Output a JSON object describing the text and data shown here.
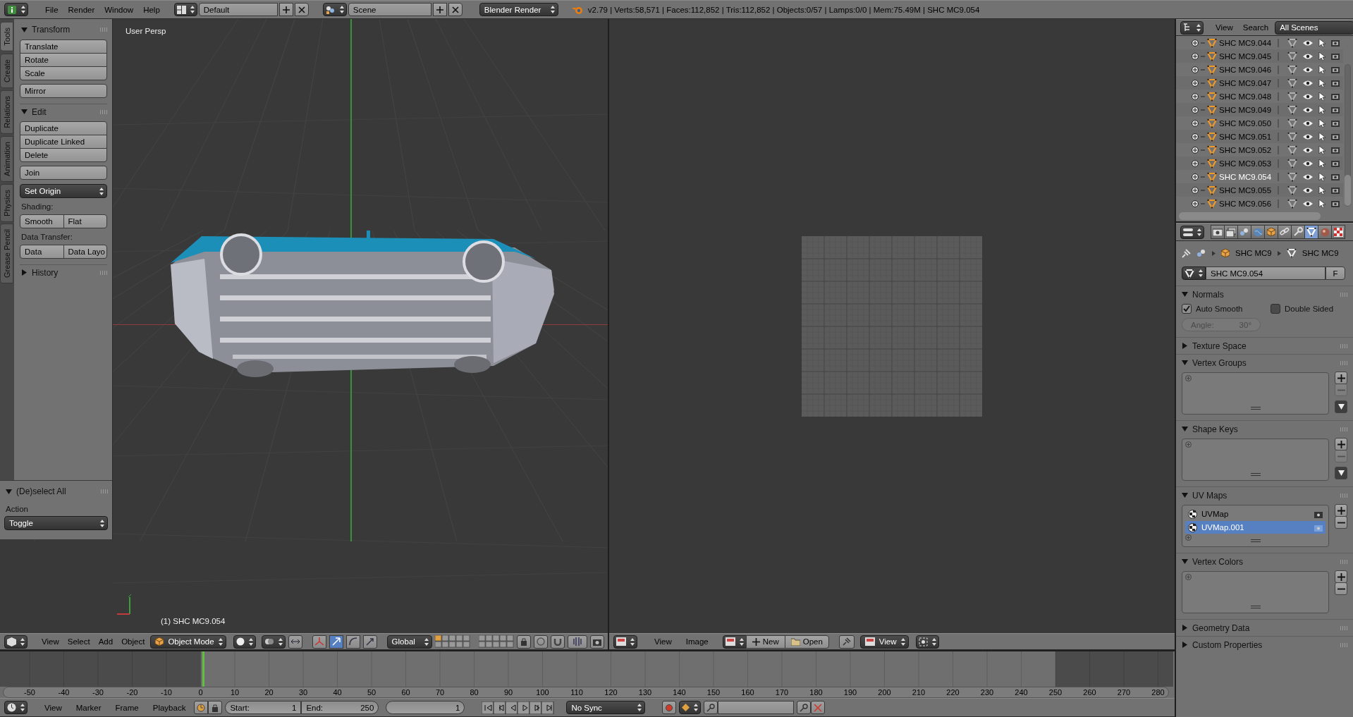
{
  "top_bar": {
    "menus": [
      "File",
      "Render",
      "Window",
      "Help"
    ],
    "screen_layout": "Default",
    "scene": "Scene",
    "render_engine": "Blender Render",
    "stats": "v2.79 | Verts:58,571 | Faces:112,852 | Tris:112,852 | Objects:0/57 | Lamps:0/0 | Mem:75.49M | SHC MC9.054"
  },
  "tool_shelf": {
    "tabs": [
      {
        "label": "Tools",
        "selected": true
      },
      {
        "label": "Create",
        "selected": false
      },
      {
        "label": "Relations",
        "selected": false
      },
      {
        "label": "Animation",
        "selected": false
      },
      {
        "label": "Physics",
        "selected": false
      },
      {
        "label": "Grease Pencil",
        "selected": false
      }
    ],
    "panels": [
      {
        "title": "Transform",
        "expanded": true,
        "items": [
          {
            "kind": "column",
            "buttons": [
              "Translate",
              "Rotate",
              "Scale"
            ]
          },
          {
            "kind": "column",
            "buttons": [
              "Mirror"
            ]
          }
        ]
      },
      {
        "title": "Edit",
        "expanded": true,
        "items": [
          {
            "kind": "column",
            "buttons": [
              "Duplicate",
              "Duplicate Linked",
              "Delete"
            ]
          },
          {
            "kind": "column",
            "buttons": [
              "Join"
            ]
          },
          {
            "kind": "dropdown",
            "value": "Set Origin"
          },
          {
            "kind": "label",
            "text": "Shading:"
          },
          {
            "kind": "row",
            "buttons": [
              "Smooth",
              "Flat"
            ]
          },
          {
            "kind": "label",
            "text": "Data Transfer:"
          },
          {
            "kind": "row",
            "buttons": [
              "Data",
              "Data Layo"
            ]
          }
        ]
      },
      {
        "title": "History",
        "expanded": false
      }
    ]
  },
  "operator_panel": {
    "title": "(De)select All",
    "expanded": true,
    "label": "Action",
    "value": "Toggle"
  },
  "viewport": {
    "view_name": "User Persp",
    "object_label": "(1) SHC MC9.054"
  },
  "view3d_header": {
    "menus": [
      "View",
      "Select",
      "Add",
      "Object"
    ],
    "mode": "Object Mode",
    "orientation": "Global"
  },
  "image_editor_header": {
    "menus": [
      "View",
      "Image"
    ],
    "buttons": [
      "New",
      "Open"
    ],
    "view": "View"
  },
  "timeline": {
    "ticks": [
      "-50",
      "-40",
      "-30",
      "-20",
      "-10",
      "0",
      "10",
      "20",
      "30",
      "40",
      "50",
      "60",
      "70",
      "80",
      "90",
      "100",
      "110",
      "120",
      "130",
      "140",
      "150",
      "160",
      "170",
      "180",
      "190",
      "200",
      "210",
      "220",
      "230",
      "240",
      "250",
      "260",
      "270",
      "280"
    ],
    "menus": [
      "View",
      "Marker",
      "Frame",
      "Playback"
    ],
    "start_label": "Start:",
    "start": "1",
    "end_label": "End:",
    "end": "250",
    "current_frame": "1",
    "sync": "No Sync"
  },
  "outliner": {
    "menus": [
      "View",
      "Search"
    ],
    "display": "All Scenes",
    "rows": [
      {
        "name": "SHC MC9.044",
        "selected": false
      },
      {
        "name": "SHC MC9.045",
        "selected": false
      },
      {
        "name": "SHC MC9.046",
        "selected": false
      },
      {
        "name": "SHC MC9.047",
        "selected": false
      },
      {
        "name": "SHC MC9.048",
        "selected": false
      },
      {
        "name": "SHC MC9.049",
        "selected": false
      },
      {
        "name": "SHC MC9.050",
        "selected": false
      },
      {
        "name": "SHC MC9.051",
        "selected": false
      },
      {
        "name": "SHC MC9.052",
        "selected": false
      },
      {
        "name": "SHC MC9.053",
        "selected": false
      },
      {
        "name": "SHC MC9.054",
        "selected": true
      },
      {
        "name": "SHC MC9.055",
        "selected": false
      },
      {
        "name": "SHC MC9.056",
        "selected": false
      }
    ]
  },
  "properties": {
    "tabs": [
      {
        "kind": "render",
        "selected": false
      },
      {
        "kind": "layers",
        "selected": false
      },
      {
        "kind": "scene",
        "selected": false
      },
      {
        "kind": "world",
        "selected": false
      },
      {
        "kind": "object",
        "selected": false
      },
      {
        "kind": "constraints",
        "selected": false
      },
      {
        "kind": "modifiers",
        "selected": false
      },
      {
        "kind": "data",
        "selected": true
      },
      {
        "kind": "material",
        "selected": false
      },
      {
        "kind": "texture",
        "selected": false
      }
    ],
    "breadcrumb": [
      "SHC MC9",
      "SHC MC9"
    ],
    "datablock": "SHC MC9.054",
    "fake_user": "F",
    "panels": [
      {
        "title": "Normals",
        "expanded": true,
        "kind": "normals",
        "checkboxes": [
          {
            "label": "Auto Smooth",
            "checked": true
          },
          {
            "label": "Double Sided",
            "checked": false
          }
        ],
        "field": {
          "label": "Angle:",
          "value": "30°",
          "disabled": true
        }
      },
      {
        "title": "Texture Space",
        "expanded": false
      },
      {
        "title": "Vertex Groups",
        "expanded": true,
        "kind": "list",
        "side_buttons": [
          {
            "kind": "add",
            "disabled": false
          },
          {
            "kind": "remove",
            "disabled": true
          },
          {
            "kind": "menu",
            "disabled": false
          }
        ]
      },
      {
        "title": "Shape Keys",
        "expanded": true,
        "kind": "list",
        "side_buttons": [
          {
            "kind": "add",
            "disabled": false
          },
          {
            "kind": "remove",
            "disabled": true
          },
          {
            "kind": "menu",
            "disabled": false
          }
        ]
      },
      {
        "title": "UV Maps",
        "expanded": true,
        "kind": "list",
        "items": [
          {
            "name": "UVMap",
            "selected": false
          },
          {
            "name": "UVMap.001",
            "selected": true
          }
        ],
        "side_buttons": [
          {
            "kind": "add",
            "disabled": false
          },
          {
            "kind": "remove",
            "disabled": false
          }
        ]
      },
      {
        "title": "Vertex Colors",
        "expanded": true,
        "kind": "list",
        "side_buttons": [
          {
            "kind": "add",
            "disabled": false
          },
          {
            "kind": "remove",
            "disabled": false
          }
        ]
      },
      {
        "title": "Geometry Data",
        "expanded": false
      },
      {
        "title": "Custom Properties",
        "expanded": false
      }
    ]
  }
}
